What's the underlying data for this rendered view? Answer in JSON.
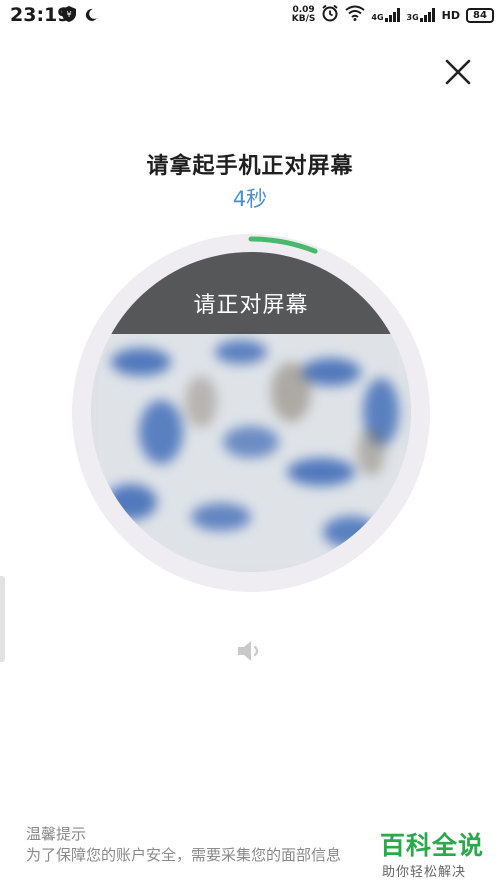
{
  "status_bar": {
    "time": "23:19",
    "net_speed_value": "0.09",
    "net_speed_unit": "KB/S",
    "signal1_label": "4G",
    "signal2_label": "3G",
    "hd_label": "HD",
    "battery": "84"
  },
  "header": {
    "close_icon": "close-icon"
  },
  "instruction": {
    "title": "请拿起手机正对屏幕",
    "countdown": "4秒"
  },
  "camera": {
    "prompt": "请正对屏幕",
    "progress_fraction": 0.06,
    "progress_color": "#49b86b",
    "ring_color": "#efedf2"
  },
  "audio": {
    "icon": "speaker-icon"
  },
  "tips": {
    "title": "温馨提示",
    "text": "为了保障您的账户安全，需要采集您的面部信息"
  },
  "watermark": {
    "main": "百科全说",
    "sub": "助你轻松解决"
  },
  "colors": {
    "accent": "#4d8fcf",
    "text": "#1f1f1f",
    "muted": "#8a8a8a",
    "brand_green": "#2ba84a"
  }
}
